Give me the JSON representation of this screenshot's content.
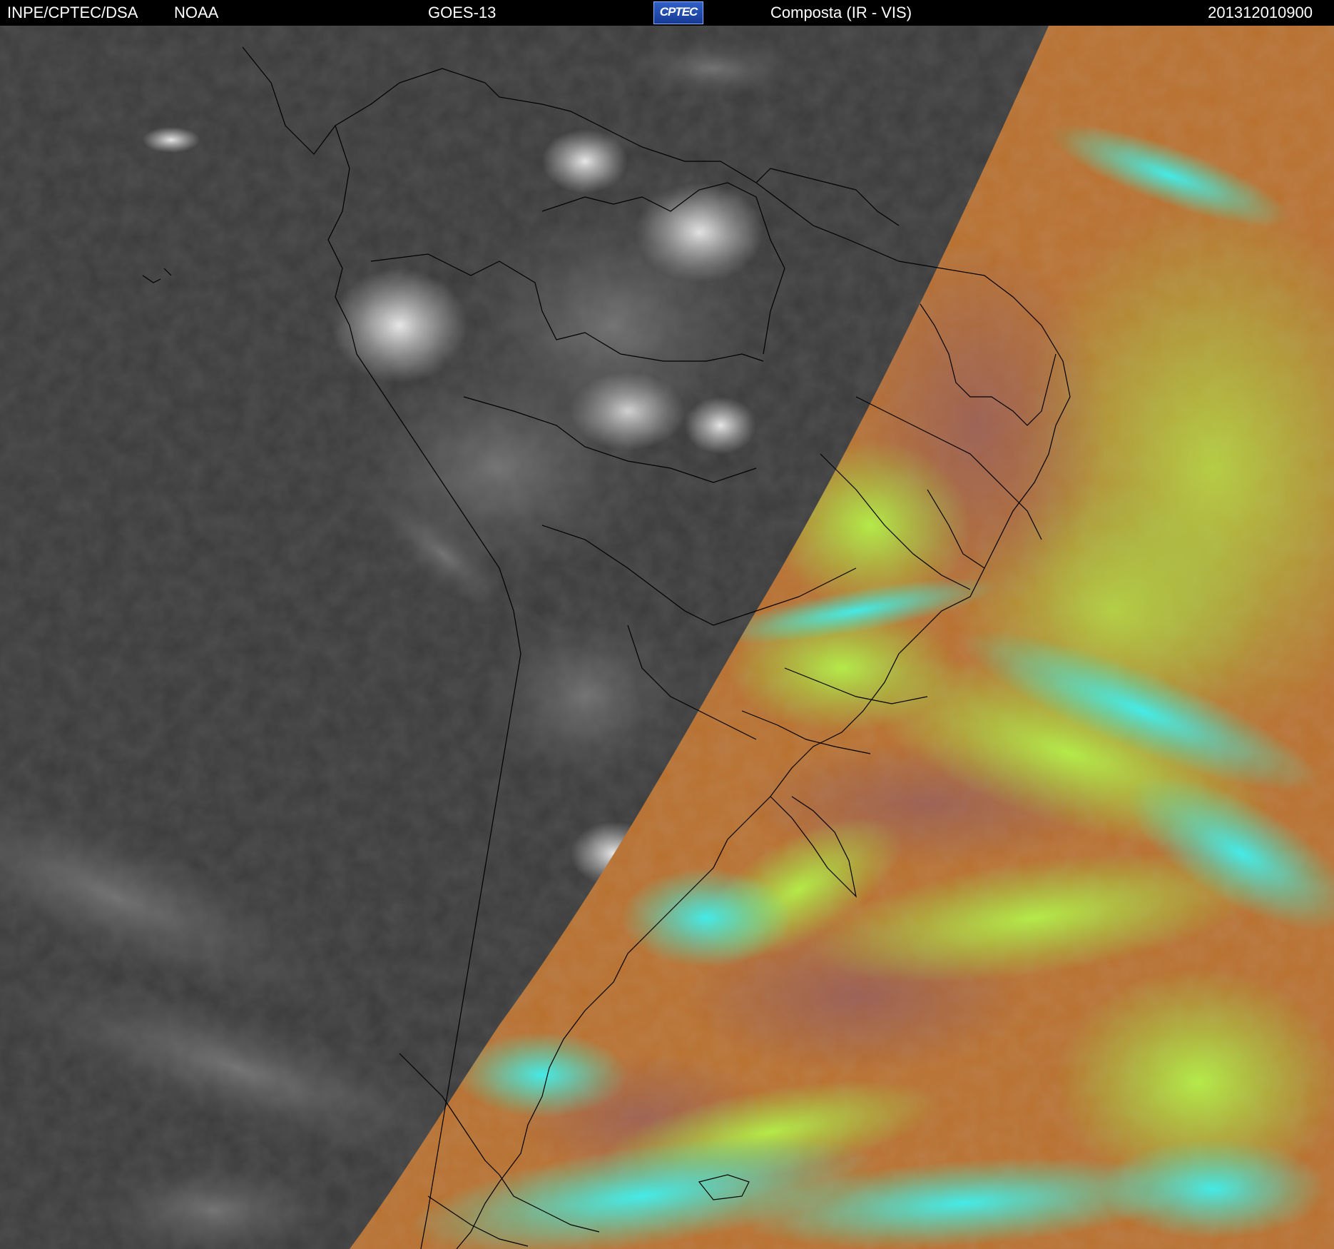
{
  "header": {
    "organization": "INPE/CPTEC/DSA",
    "agency": "NOAA",
    "satellite": "GOES-13",
    "product": "Composta (IR - VIS)",
    "timestamp": "201312010900",
    "logo_text": "CPTEC"
  },
  "colors": {
    "header_bg": "#000000",
    "header_text": "#ffffff",
    "ir_background": "#3a3a3a",
    "ir_clouds": "#e6e6e6",
    "vis_land": "#9a5a4a",
    "vis_ocean": "#b7702c",
    "vis_green_clouds": "#a6ef4a",
    "vis_cyan_clouds": "#3feeee",
    "border_lines": "#000000"
  }
}
